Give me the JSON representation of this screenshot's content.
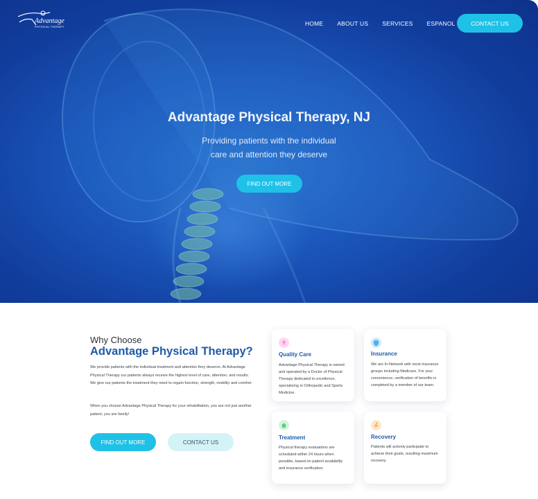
{
  "header": {
    "logo_text": "Advantage",
    "logo_sub": "PHYSICAL THERAPY",
    "nav": [
      "HOME",
      "ABOUT US",
      "SERVICES",
      "ESPANOL"
    ],
    "contact_label": "CONTACT US"
  },
  "hero": {
    "title": "Advantage Physical Therapy, NJ",
    "subtitle": "Providing patients with the individual care and attention they deserve",
    "button": "FIND OUT MORE"
  },
  "why": {
    "small_heading": "Why Choose",
    "big_heading": "Advantage Physical Therapy?",
    "paragraph1": "We provide patients with the individual treatment and attention they deserve. At Advantage Physical Therapy our patients always receive the highest level of care, attention, and results. We give our patients the treatment they need to regain function, strength, mobility and comfort.",
    "paragraph2": "When you choose Advantage Physical Therapy for your rehabilitation, you are not just another patient, you are family!",
    "find_button": "FIND OUT MORE",
    "contact_button": "CONTACT US"
  },
  "cards": [
    {
      "title": "Quality Care",
      "text": "Advantage Physical Therapy is owned and operated by a Doctor of Physical Therapy dedicated to excellence, specializing in Orthopedic and Sports Medicine.",
      "icon": "lightbulb-icon",
      "color": "#ff8fd6"
    },
    {
      "title": "Insurance",
      "text": "We are In-Network with most insurance groups including Medicare. For your convenience, verification of benefits is completed by a member of our team.",
      "icon": "shield-icon",
      "color": "#4fb3e8"
    },
    {
      "title": "Treatment",
      "text": "Physical therapy evaluations are scheduled within 24 hours when possible, based on patient availability and insurance verification.",
      "icon": "home-icon",
      "color": "#5ccf7a"
    },
    {
      "title": "Recovery",
      "text": "Patients will actively participate to achieve their goals, resulting maximum recovery.",
      "icon": "runner-icon",
      "color": "#f2a93b"
    }
  ]
}
